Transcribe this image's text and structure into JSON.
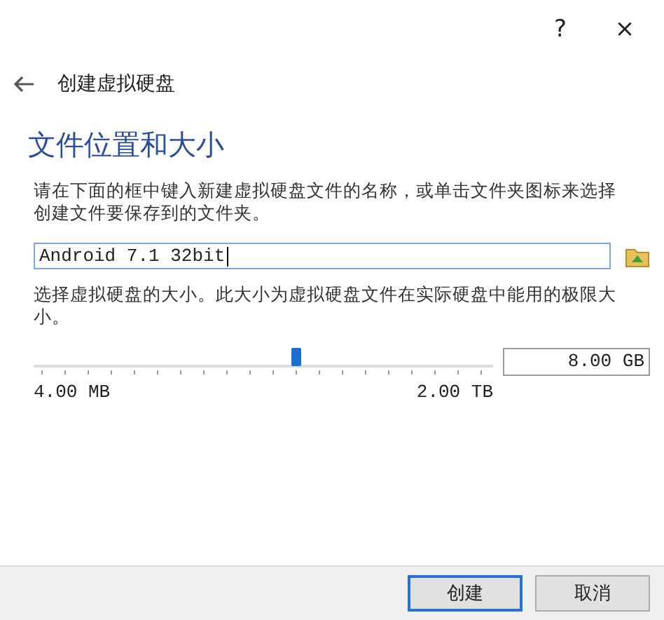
{
  "window": {
    "help": "?",
    "close": "×"
  },
  "header": {
    "title": "创建虚拟硬盘"
  },
  "section": {
    "heading": "文件位置和大小"
  },
  "location": {
    "description": "请在下面的框中键入新建虚拟硬盘文件的名称，或单击文件夹图标来选择创建文件要保存到的文件夹。",
    "value": "Android 7.1 32bit",
    "focused": true
  },
  "size": {
    "description": "选择虚拟硬盘的大小。此大小为虚拟硬盘文件在实际硬盘中能用的极限大小。",
    "level": 0.57,
    "value": "8.00 GB",
    "min_label": "4.00 MB",
    "max_label": "2.00 TB"
  },
  "buttons": [
    {
      "label": "创建",
      "default": true
    },
    {
      "label": "取消",
      "default": false
    }
  ]
}
